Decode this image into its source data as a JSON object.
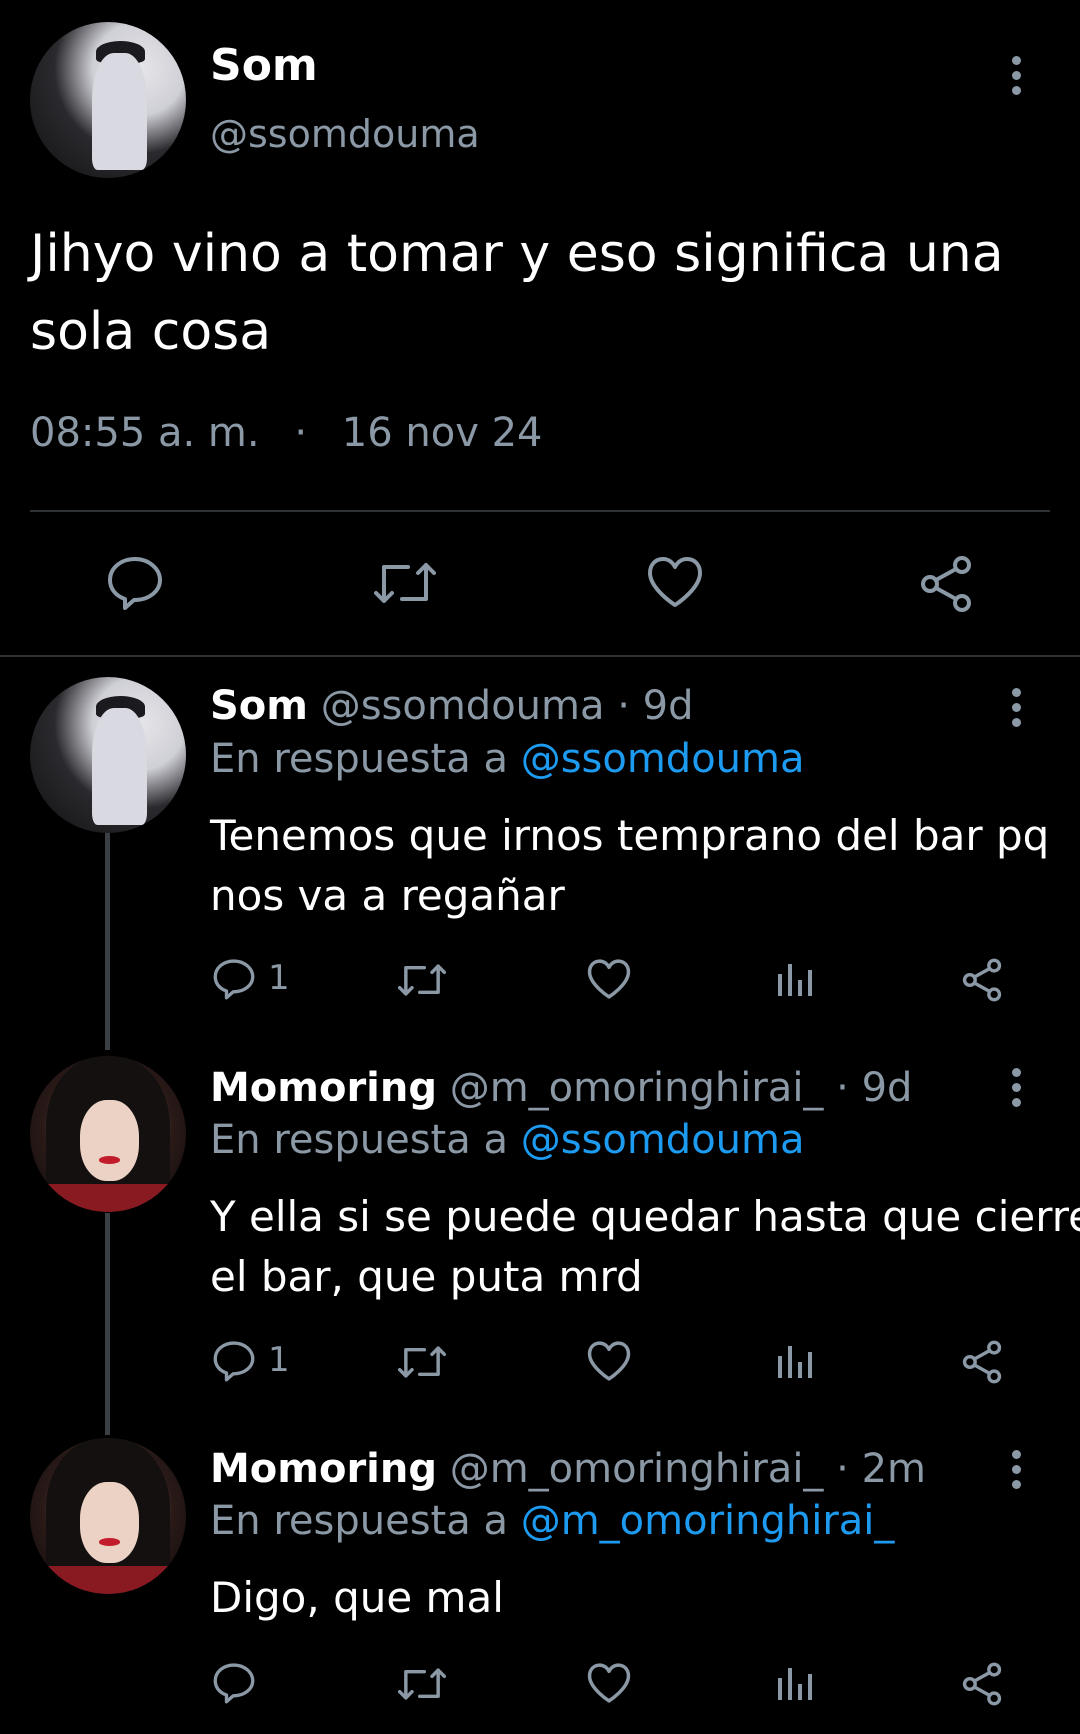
{
  "main_tweet": {
    "display_name": "Som",
    "handle": "@ssomdouma",
    "text_line1": "Jihyo vino a tomar y eso significa una",
    "text_line2": "sola cosa",
    "time": "08:55 a. m.",
    "separator": "·",
    "date": "16 nov 24",
    "icons": [
      "reply-icon",
      "retweet-icon",
      "like-icon",
      "share-icon"
    ]
  },
  "replies": [
    {
      "display_name": "Som",
      "handle": "@ssomdouma",
      "age": "· 9d",
      "reply_prefix": "En respuesta a",
      "reply_to": "@ssomdouma",
      "text_line1": "Tenemos que irnos temprano del bar pq",
      "text_line2": "nos va a regañar",
      "reply_count": "1"
    },
    {
      "display_name": "Momoring",
      "handle": "@m_omoringhirai_",
      "age": "· 9d",
      "reply_prefix": "En respuesta a",
      "reply_to": "@ssomdouma",
      "text_line1": "Y ella si se puede quedar hasta que cierre",
      "text_line2": "el bar, que puta mrd",
      "reply_count": "1"
    },
    {
      "display_name": "Momoring",
      "handle": "@m_omoringhirai_",
      "age": "· 2m",
      "reply_prefix": "En respuesta a",
      "reply_to": "@m_omoringhirai_",
      "text_line1": "Digo, que mal",
      "text_line2": "",
      "reply_count": ""
    }
  ],
  "colors": {
    "background": "#000000",
    "text": "#ffffff",
    "muted": "#8b98a5",
    "link": "#1d9bf0"
  }
}
